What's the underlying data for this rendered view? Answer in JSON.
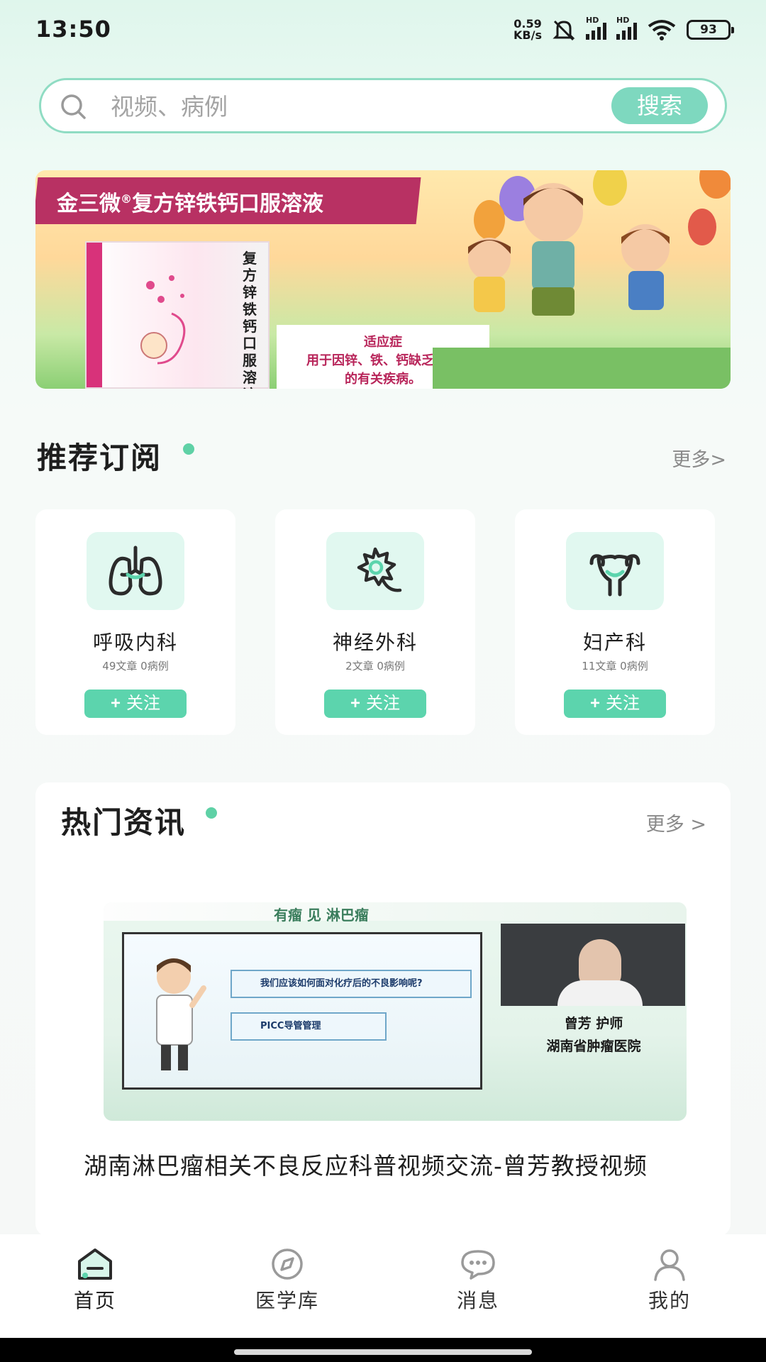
{
  "status_bar": {
    "time": "13:50",
    "net_speed_value": "0.59",
    "net_speed_unit": "KB/s",
    "hd_label": "HD",
    "battery": "93"
  },
  "search": {
    "placeholder": "视频、病例",
    "button_label": "搜索"
  },
  "banner": {
    "title": "金三微",
    "title_mark": "®",
    "title_rest": "复方锌铁钙口服溶液",
    "product_name": "复方锌铁钙口服溶液",
    "caption_heading": "适应症",
    "caption_line1": "用于因锌、铁、钙缺乏引起",
    "caption_line2": "的有关疾病。"
  },
  "recommended": {
    "title": "推荐订阅",
    "more": "更多>",
    "items": [
      {
        "name": "呼吸内科",
        "meta": "49文章  0病例",
        "follow_label": "关注",
        "icon": "lungs-icon"
      },
      {
        "name": "神经外科",
        "meta": "2文章  0病例",
        "follow_label": "关注",
        "icon": "neuron-icon"
      },
      {
        "name": "妇产科",
        "meta": "11文章  0病例",
        "follow_label": "关注",
        "icon": "uterus-icon"
      }
    ]
  },
  "hot_news": {
    "title": "热门资讯",
    "more": "更多 >",
    "thumbnail": {
      "header_text": "有瘤 见 淋巴瘤",
      "question1": "我们应该如何面对化疗后的不良影响呢?",
      "question2": "PICC导管管理",
      "speaker": "曾芳 护师",
      "hospital": "湖南省肿瘤医院"
    },
    "article_title": "湖南淋巴瘤相关不良反应科普视频交流-曾芳教授视频"
  },
  "bottom_nav": {
    "items": [
      {
        "label": "首页",
        "icon": "home-icon",
        "active": true
      },
      {
        "label": "医学库",
        "icon": "compass-icon",
        "active": false
      },
      {
        "label": "消息",
        "icon": "chat-icon",
        "active": false
      },
      {
        "label": "我的",
        "icon": "user-icon",
        "active": false
      }
    ]
  },
  "colors": {
    "accent": "#5cd4ad",
    "search_border": "#8fdcc3",
    "banner_title_bg": "#b83163"
  }
}
